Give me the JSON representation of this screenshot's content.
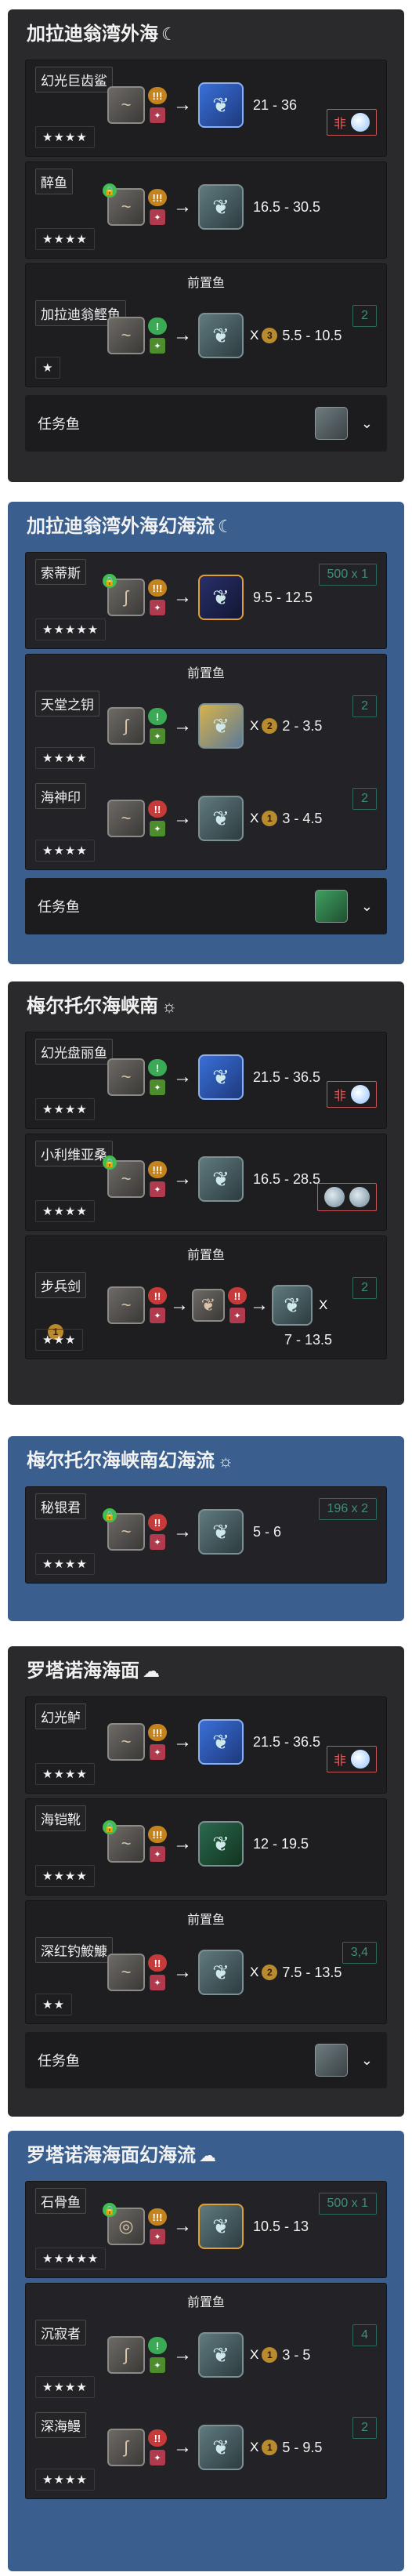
{
  "zones": [
    {
      "title": "加拉迪翁湾外海",
      "weather_icon": "☾",
      "fish": [
        {
          "name": "幻光巨齿鲨",
          "stars": "★★★★",
          "tug": "!!!",
          "range": "21 - 36",
          "cond_label": "非",
          "cond_icon": "moon-icon"
        },
        {
          "name": "醉鱼",
          "stars": "★★★★",
          "tug": "!!!",
          "range": "16.5 - 30.5"
        }
      ],
      "pre_label": "前置鱼",
      "pre": [
        {
          "name": "加拉迪翁鲣鱼",
          "stars": "★",
          "tug": "!",
          "mult": "X",
          "coin": "3",
          "range": "5.5 - 10.5",
          "tag": "2"
        }
      ],
      "quest_label": "任务鱼"
    },
    {
      "title": "加拉迪翁湾外海幻海流",
      "weather_icon": "☾",
      "fish": [
        {
          "name": "索蒂斯",
          "stars": "★★★★★",
          "tug": "!!!",
          "range": "9.5 - 12.5",
          "tag": "500 x 1"
        }
      ],
      "pre_label": "前置鱼",
      "pre": [
        {
          "name": "天堂之钥",
          "stars": "★★★★",
          "tug": "!",
          "mult": "X",
          "coin": "2",
          "range": "2 - 3.5",
          "tag": "2"
        },
        {
          "name": "海神印",
          "stars": "★★★★",
          "tug": "!!",
          "mult": "X",
          "coin": "1",
          "range": "3 - 4.5",
          "tag": "2"
        }
      ],
      "quest_label": "任务鱼"
    },
    {
      "title": "梅尔托尔海峡南",
      "weather_icon": "☼",
      "fish": [
        {
          "name": "幻光盘丽鱼",
          "stars": "★★★★",
          "tug": "!",
          "range": "21.5 - 36.5",
          "cond_label": "非",
          "cond_icon": "moon-icon"
        },
        {
          "name": "小利维亚桑",
          "stars": "★★★★",
          "tug": "!!!",
          "range": "16.5 - 28.5",
          "cond_icon": "weather-icon"
        }
      ],
      "pre_label": "前置鱼",
      "pre": [
        {
          "name": "步兵剑",
          "stars": "★★★",
          "tug": "!!",
          "mult": "X",
          "range": "7 - 13.5",
          "tag": "2",
          "coin": "1"
        }
      ]
    },
    {
      "title": "梅尔托尔海峡南幻海流",
      "weather_icon": "☼",
      "fish": [
        {
          "name": "秘银君",
          "stars": "★★★★",
          "tug": "!!",
          "range": "5 - 6",
          "tag": "196 x 2"
        }
      ]
    },
    {
      "title": "罗塔诺海海面",
      "weather_icon": "☁",
      "fish": [
        {
          "name": "幻光鲈",
          "stars": "★★★★",
          "tug": "!!!",
          "range": "21.5 - 36.5",
          "cond_label": "非",
          "cond_icon": "moon-icon"
        },
        {
          "name": "海铠靴",
          "stars": "★★★★",
          "tug": "!!!",
          "range": "12 - 19.5"
        }
      ],
      "pre_label": "前置鱼",
      "pre": [
        {
          "name": "深红钓鮟鱇",
          "stars": "★★",
          "tug": "!!",
          "mult": "X",
          "coin": "2",
          "range": "7.5 - 13.5",
          "tag": "3,4"
        }
      ],
      "quest_label": "任务鱼"
    },
    {
      "title": "罗塔诺海海面幻海流",
      "weather_icon": "☁",
      "fish": [
        {
          "name": "石骨鱼",
          "stars": "★★★★★",
          "tug": "!!!",
          "range": "10.5 - 13",
          "tag": "500 x 1"
        }
      ],
      "pre_label": "前置鱼",
      "pre": [
        {
          "name": "沉寂者",
          "stars": "★★★★",
          "tug": "!",
          "mult": "X",
          "coin": "1",
          "range": "3 - 5",
          "tag": "4"
        },
        {
          "name": "深海鳗",
          "stars": "★★★★",
          "tug": "!!",
          "mult": "X",
          "coin": "1",
          "range": "5 - 9.5",
          "tag": "2"
        }
      ]
    }
  ]
}
